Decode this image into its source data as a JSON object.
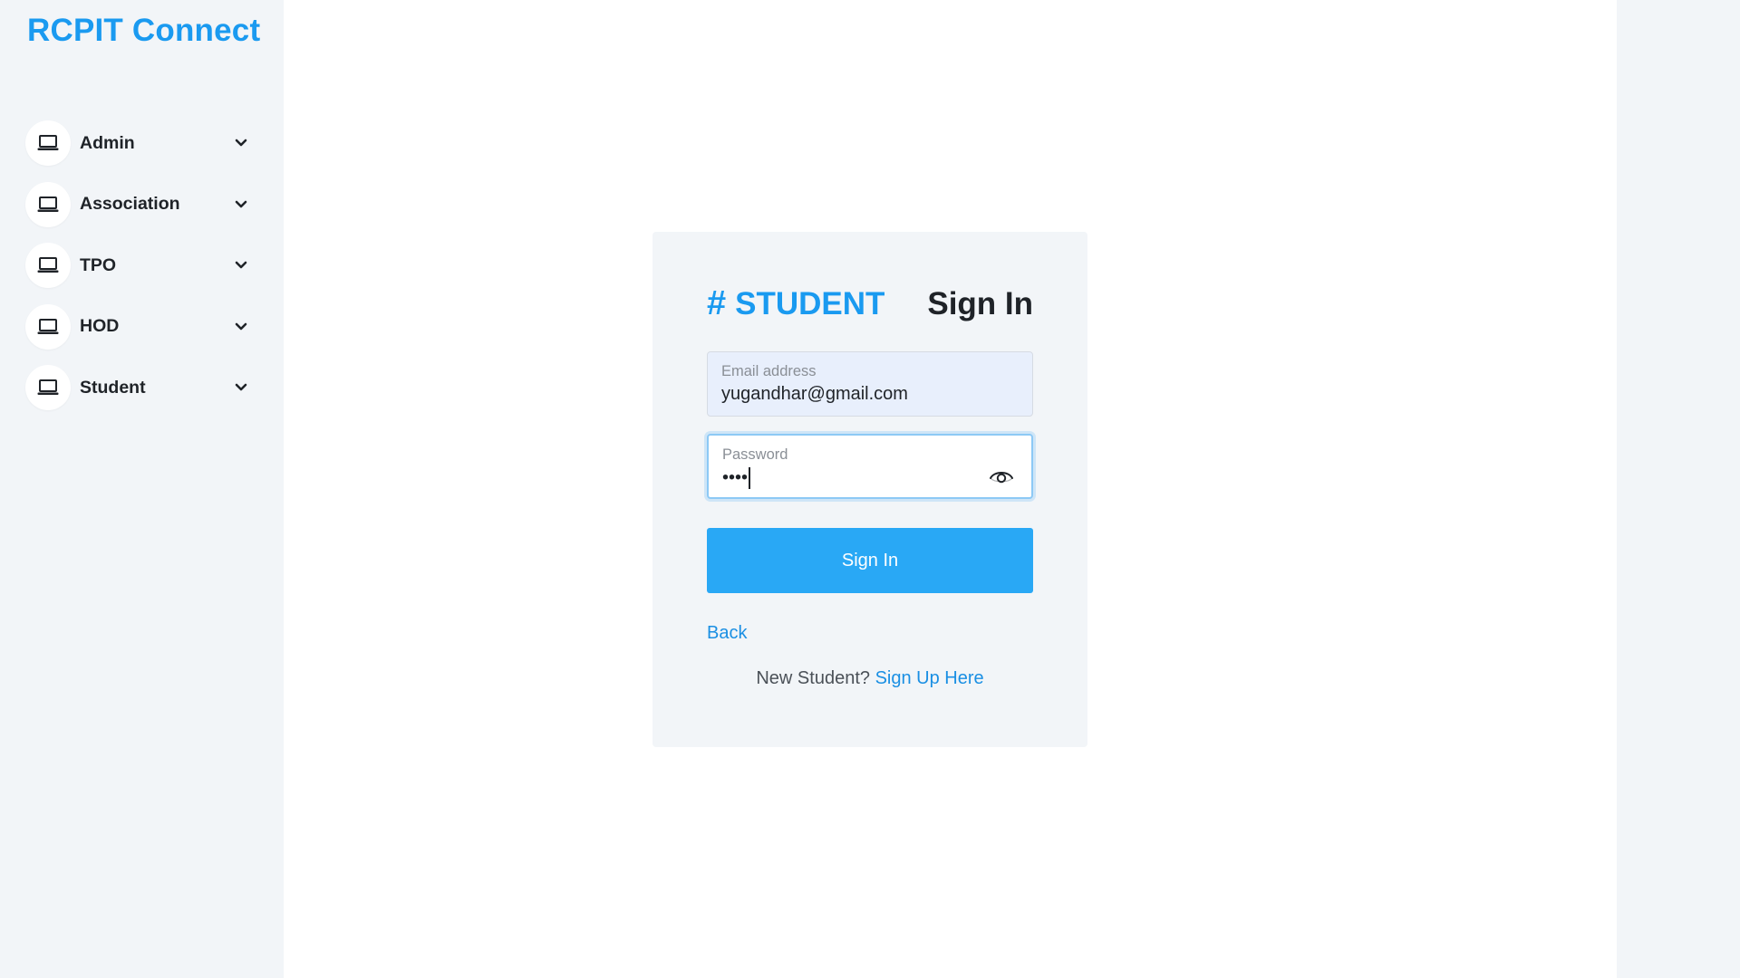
{
  "sidebar": {
    "brand": "RCPIT Connect",
    "items": [
      {
        "label": "Admin",
        "icon": "laptop-icon"
      },
      {
        "label": "Association",
        "icon": "laptop-icon"
      },
      {
        "label": "TPO",
        "icon": "laptop-icon"
      },
      {
        "label": "HOD",
        "icon": "laptop-icon"
      },
      {
        "label": "Student",
        "icon": "laptop-icon"
      }
    ]
  },
  "card": {
    "role_hash": "#",
    "role": "STUDENT",
    "title": "Sign In",
    "email": {
      "label": "Email address",
      "value": "yugandhar@gmail.com"
    },
    "password": {
      "label": "Password",
      "masked_value": "••••"
    },
    "submit_label": "Sign In",
    "back_label": "Back",
    "signup_prompt": "New Student?",
    "signup_link": "Sign Up Here"
  },
  "colors": {
    "accent": "#1a9af0",
    "button": "#29a8f5",
    "sidebar_bg": "#f2f5f8",
    "email_bg": "#e8effc",
    "focus_border": "#8dc9f5"
  }
}
